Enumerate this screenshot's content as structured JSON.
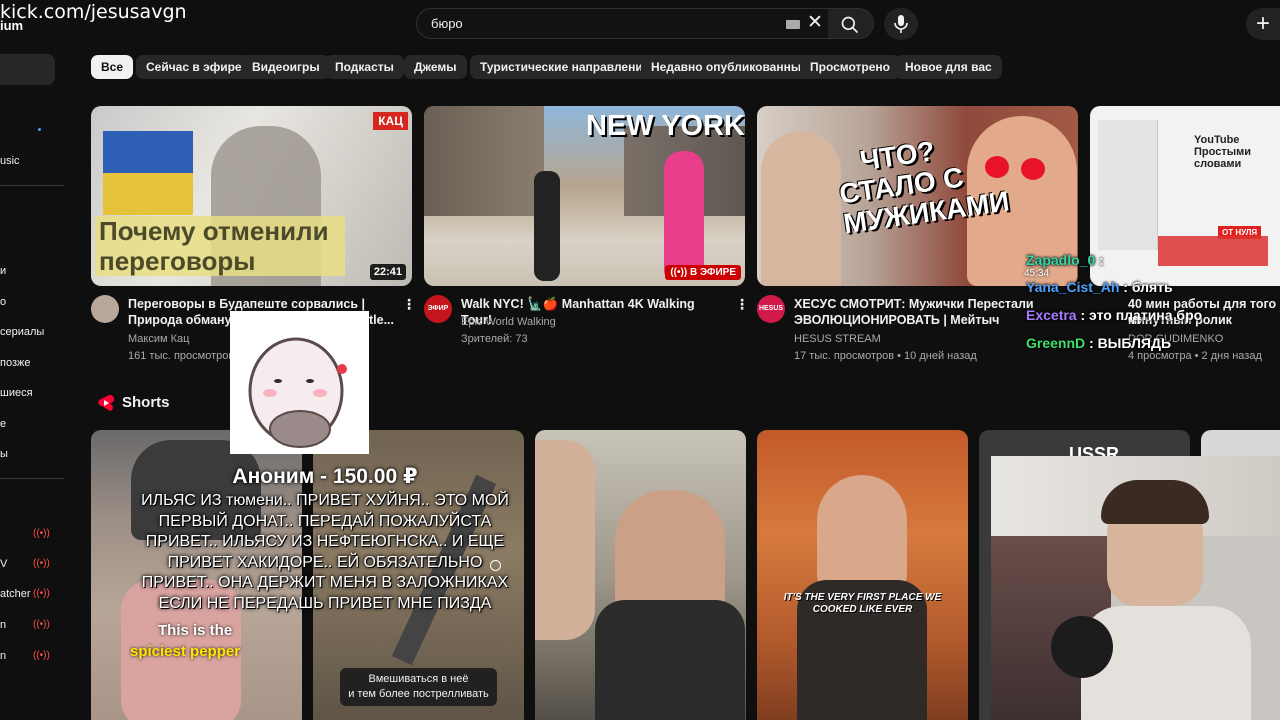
{
  "overlay": {
    "kick_url": "kick.com/jesusavgn",
    "logo_fragment": "ium"
  },
  "header": {
    "search_value": "бюро",
    "clear_symbol": "✕",
    "create_symbol": "+",
    "icons": [
      "keyboard-icon",
      "clear-icon",
      "search-icon",
      "mic-icon",
      "create-icon"
    ]
  },
  "chips": [
    "Все",
    "Сейчас в эфире",
    "Видеоигры",
    "Подкасты",
    "Джемы",
    "Туристические направления",
    "Недавно опубликованные",
    "Просмотрено",
    "Новое для вас"
  ],
  "sidebar": {
    "items": [
      "usic",
      "и",
      "о",
      "сериалы",
      "позже",
      "шиеся",
      "е",
      "ы",
      "V",
      "atcher",
      "n",
      "n"
    ]
  },
  "videos": [
    {
      "thumb_text": "Почему отменили переговоры",
      "thumb_badge": "КАЦ",
      "duration": "22:41",
      "title": "Переговоры в Будапеште сорвались | Природа обманут",
      "title_tail": "tle...",
      "channel": "Максим Кац",
      "meta": "161 тыс. просмотров"
    },
    {
      "thumb_text": "NEW YORK",
      "live_label": "В ЭФИРЕ",
      "avatar_text": "ЭФИР",
      "title": "Walk NYC! 🗽🍎 Manhattan 4K Walking Tour!",
      "channel": "Epic World Walking",
      "meta": "Зрителей: 73"
    },
    {
      "thumb_text": "ЧТО? СТАЛО С МУЖИКАМИ",
      "avatar_text": "HESUS",
      "title": "ХЕСУС СМОТРИТ: Мужички Перестали ЭВОЛЮЦИОНИРОВАТЬ | Мейтыч",
      "channel": "HESUS STREAM",
      "meta": "17 тыс. просмотров • 10 дней назад"
    },
    {
      "thumb_text": "YouTube Простыми словами",
      "thumb_badge": "ОТ НУЛЯ",
      "title": "40 мин работы для того чт",
      "title_line2": "минутный ролик",
      "channel": "DOR GUDIMENKO",
      "meta": "4 просмотра • 2 дня назад",
      "timer": "45:34"
    }
  ],
  "shorts": {
    "label": "Shorts",
    "items": [
      {
        "caption_white": "This is the",
        "caption_yellow": "spiciest pepper"
      },
      {
        "tooltip_line1": "Вмешиваться в неё",
        "tooltip_line2": "и тем более пострелливать"
      },
      {},
      {
        "caption": "IT'S THE VERY FIRST PLACE WE COOKED LIKE EVER"
      },
      {
        "top_text": "USSR"
      }
    ]
  },
  "donation": {
    "header": "Аноним - 150.00 ₽",
    "message": "ИЛЬЯС ИЗ тюмени.. ПРИВЕТ ХУЙНЯ.. ЭТО МОЙ ПЕРВЫЙ ДОНАТ.. ПЕРЕДАЙ ПОЖАЛУЙСТА ПРИВЕТ.. ИЛЬЯСУ ИЗ НЕФТЕЮГНСКА.. И ЕЩЕ ПРИВЕТ ХАКИДОРЕ.. ЕЙ ОБЯЗАТЕЛЬНО ПРИВЕТ.. ОНА ДЕРЖИТ МЕНЯ В ЗАЛОЖНИКАХ ЕСЛИ НЕ ПЕРЕДАШЬ ПРИВЕТ МНЕ ПИЗДА"
  },
  "chat": [
    {
      "user": "Zapadlo_0",
      "msg": ":",
      "color": "#2fd8a6"
    },
    {
      "user": "Yana_Cist_Ah",
      "msg": ": блять",
      "color": "#4ea1ff"
    },
    {
      "user": "Excetra",
      "msg": ": это платина бро",
      "color": "#a77bff"
    },
    {
      "user": "GreennD",
      "msg": ": ВЫБЛЯДЬ",
      "color": "#3ee06a"
    }
  ],
  "colors": {
    "background": "#0f0f0f",
    "chip": "#272727",
    "chip_active": "#f1f1f1",
    "live_red": "#cc0000",
    "text_secondary": "#aaaaaa"
  }
}
